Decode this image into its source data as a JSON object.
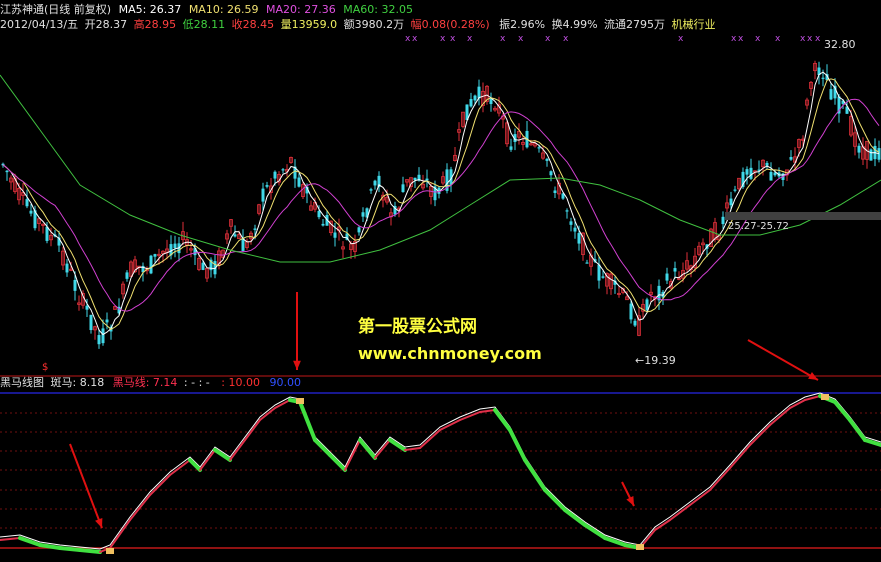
{
  "colors": {
    "background": "#000000",
    "bull": "#e0303a",
    "bear": "#40d8e8",
    "ma5": "#ffffff",
    "ma10": "#f0e070",
    "ma20": "#d040d0",
    "ma60": "#40c040",
    "panel_border": "#c01818",
    "upper_band": "#2020c0",
    "lower_band": "#c01818",
    "indicator_up": "#e0304a",
    "indicator_down": "#40e040",
    "indicator_white": "#ffffff",
    "arrow": "#e01010",
    "watermark": "#ffff40"
  },
  "header": {
    "stock": "江苏神通(日线 前复权)",
    "ma5": "MA5: 26.37",
    "ma10": "MA10: 26.59",
    "ma20": "MA20: 27.36",
    "ma60": "MA60: 32.05",
    "date": "2012/04/13/五",
    "open": "开28.37",
    "high": "高28.95",
    "low": "低28.11",
    "close": "收28.45",
    "volume": "量13959.0",
    "amount": "额3980.2万",
    "change": "幅0.08(0.28%)",
    "amplitude": "振2.96%",
    "turnover": "换4.99%",
    "float": "流通2795万",
    "industry": "机械行业"
  },
  "price_panel": {
    "high_label": "32.80",
    "low_label": "←19.39",
    "range_label": "25.27-25.72"
  },
  "watermark": {
    "title": "第一股票公式网",
    "url": "www.chnmoney.com"
  },
  "indicator_panel": {
    "name": "黑马线图",
    "spot_label": "斑马: 8.18",
    "black_horse_label": "黑马线: 7.14",
    "dashes": ": - : -",
    "low_level": ": 10.00",
    "high_level": "90.00"
  },
  "signal_marker": "$"
}
